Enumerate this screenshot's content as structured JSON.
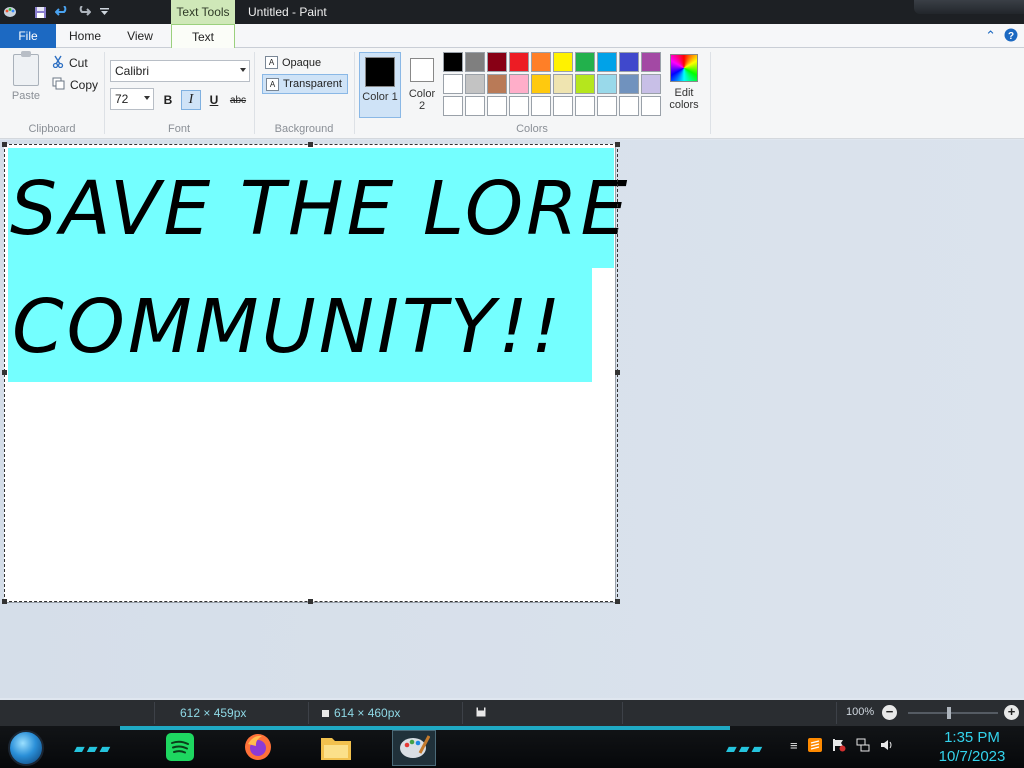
{
  "titlebar": {
    "contextual_tab": "Text Tools",
    "document_title": "Untitled - Paint"
  },
  "tabs": {
    "file": "File",
    "home": "Home",
    "view": "View",
    "text": "Text"
  },
  "clipboard": {
    "paste": "Paste",
    "cut": "Cut",
    "copy": "Copy",
    "label": "Clipboard"
  },
  "font": {
    "name": "Calibri",
    "size": "72",
    "bold": "B",
    "italic": "I",
    "underline": "U",
    "strikethrough": "abc",
    "label": "Font"
  },
  "background": {
    "opaque": "Opaque",
    "transparent": "Transparent",
    "label": "Background"
  },
  "colors": {
    "color1_label": "Color 1",
    "color1_value": "#000000",
    "color2_label": "Color 2",
    "color2_value": "#ffffff",
    "edit_label": "Edit colors",
    "label": "Colors",
    "palette": [
      "#000000",
      "#7f7f7f",
      "#880015",
      "#ed1c24",
      "#ff7f27",
      "#fff200",
      "#22b14c",
      "#00a2e8",
      "#3f48cc",
      "#a349a4",
      "#ffffff",
      "#c3c3c3",
      "#b97a57",
      "#ffaec9",
      "#ffc90e",
      "#efe4b0",
      "#b5e61d",
      "#99d9ea",
      "#7092be",
      "#c8bfe7",
      "#ffffff",
      "#ffffff",
      "#ffffff",
      "#ffffff",
      "#ffffff",
      "#ffffff",
      "#ffffff",
      "#ffffff",
      "#ffffff",
      "#ffffff"
    ]
  },
  "canvas": {
    "line1": "SAVE THE LORE",
    "line2": "COMMUNITY!!",
    "highlight_color": "#74ffff"
  },
  "status": {
    "selection_size": "612 × 459px",
    "image_size": "614 × 460px",
    "zoom": "100%"
  },
  "taskbar": {
    "time": "1:35 PM",
    "date": "10/7/2023"
  }
}
